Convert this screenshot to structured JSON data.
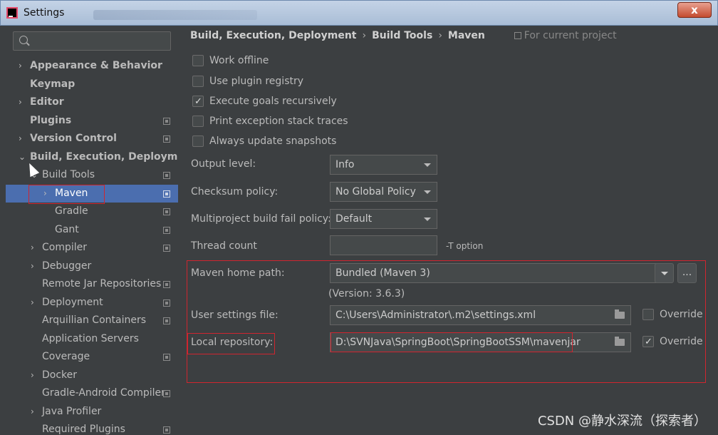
{
  "window": {
    "title": "Settings",
    "close_label": "x"
  },
  "search": {
    "placeholder": ""
  },
  "tree": [
    {
      "label": "Appearance & Behavior",
      "bold": true,
      "arrow": "›",
      "indent": 0,
      "proj": false
    },
    {
      "label": "Keymap",
      "bold": true,
      "arrow": "",
      "indent": 0,
      "proj": false
    },
    {
      "label": "Editor",
      "bold": true,
      "arrow": "›",
      "indent": 0,
      "proj": false
    },
    {
      "label": "Plugins",
      "bold": true,
      "arrow": "",
      "indent": 0,
      "proj": true
    },
    {
      "label": "Version Control",
      "bold": true,
      "arrow": "›",
      "indent": 0,
      "proj": true
    },
    {
      "label": "Build, Execution, Deployment",
      "bold": true,
      "arrow": "⌄",
      "indent": 0,
      "proj": false
    },
    {
      "label": "Build Tools",
      "bold": false,
      "arrow": "⌄",
      "indent": 1,
      "proj": true
    },
    {
      "label": "Maven",
      "bold": false,
      "arrow": "›",
      "indent": 2,
      "proj": true,
      "selected": true
    },
    {
      "label": "Gradle",
      "bold": false,
      "arrow": "",
      "indent": 2,
      "proj": true
    },
    {
      "label": "Gant",
      "bold": false,
      "arrow": "",
      "indent": 2,
      "proj": true
    },
    {
      "label": "Compiler",
      "bold": false,
      "arrow": "›",
      "indent": 1,
      "proj": true
    },
    {
      "label": "Debugger",
      "bold": false,
      "arrow": "›",
      "indent": 1,
      "proj": false
    },
    {
      "label": "Remote Jar Repositories",
      "bold": false,
      "arrow": "",
      "indent": 1,
      "proj": true
    },
    {
      "label": "Deployment",
      "bold": false,
      "arrow": "›",
      "indent": 1,
      "proj": true
    },
    {
      "label": "Arquillian Containers",
      "bold": false,
      "arrow": "",
      "indent": 1,
      "proj": true
    },
    {
      "label": "Application Servers",
      "bold": false,
      "arrow": "",
      "indent": 1,
      "proj": false
    },
    {
      "label": "Coverage",
      "bold": false,
      "arrow": "",
      "indent": 1,
      "proj": true
    },
    {
      "label": "Docker",
      "bold": false,
      "arrow": "›",
      "indent": 1,
      "proj": false
    },
    {
      "label": "Gradle-Android Compiler",
      "bold": false,
      "arrow": "",
      "indent": 1,
      "proj": true
    },
    {
      "label": "Java Profiler",
      "bold": false,
      "arrow": "›",
      "indent": 1,
      "proj": false
    },
    {
      "label": "Required Plugins",
      "bold": false,
      "arrow": "",
      "indent": 1,
      "proj": true
    }
  ],
  "breadcrumb": {
    "items": [
      "Build, Execution, Deployment",
      "Build Tools",
      "Maven"
    ],
    "separator": "›",
    "scope": "For current project"
  },
  "checkboxes": [
    {
      "label": "Work offline",
      "checked": false
    },
    {
      "label": "Use plugin registry",
      "checked": false
    },
    {
      "label": "Execute goals recursively",
      "checked": true
    },
    {
      "label": "Print exception stack traces",
      "checked": false
    },
    {
      "label": "Always update snapshots",
      "checked": false
    }
  ],
  "form": {
    "output_level": {
      "label": "Output level:",
      "value": "Info"
    },
    "checksum_policy": {
      "label": "Checksum policy:",
      "value": "No Global Policy"
    },
    "fail_policy": {
      "label": "Multiproject build fail policy:",
      "value": "Default"
    },
    "thread_count": {
      "label": "Thread count",
      "value": "",
      "hint": "-T option"
    },
    "maven_home": {
      "label": "Maven home path:",
      "value": "Bundled (Maven 3)",
      "browse": "...",
      "version": "(Version: 3.6.3)"
    },
    "user_settings": {
      "label": "User settings file:",
      "value": "C:\\Users\\Administrator\\.m2\\settings.xml",
      "override_label": "Override",
      "override": false
    },
    "local_repo": {
      "label": "Local repository:",
      "value": "D:\\SVNJava\\SpringBoot\\SpringBootSSM\\mavenjar",
      "override_label": "Override",
      "override": true
    }
  },
  "watermark": "CSDN @静水深流（探索者）",
  "colors": {
    "background": "#3c3f41",
    "selection": "#4b6eaf",
    "highlight_box": "#d0252f"
  }
}
